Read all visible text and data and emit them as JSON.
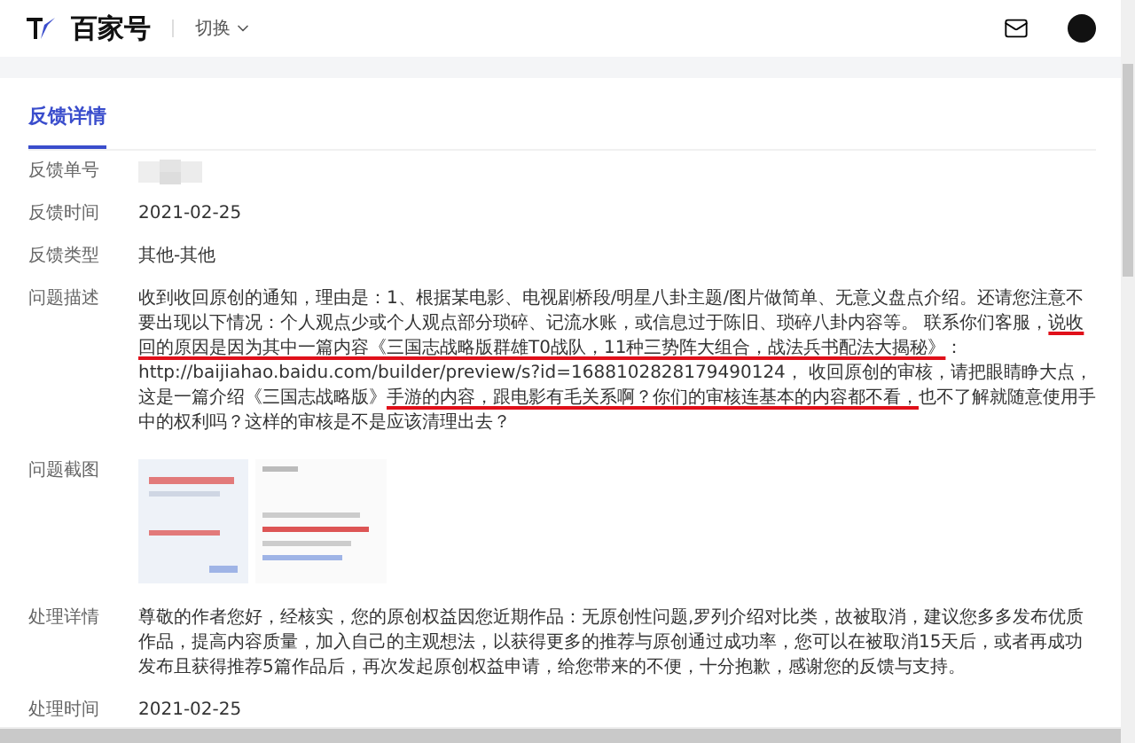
{
  "header": {
    "logo_text": "百家号",
    "switch_label": "切换"
  },
  "tabs": [
    {
      "label": "反馈详情",
      "selected": true
    }
  ],
  "fields": [
    {
      "kind": "redacted",
      "label": "反馈单号"
    },
    {
      "kind": "text",
      "label": "反馈时间",
      "value": "2021-02-25"
    },
    {
      "kind": "text",
      "label": "反馈类型",
      "value": "其他-其他"
    },
    {
      "kind": "marked",
      "label": "问题描述",
      "segments": [
        {
          "text": "收到收回原创的通知，理由是：1、根据某电影、电视剧桥段/明星八卦主题/图片做简单、无意义盘点介绍。还请您注意不要出现以下情况：个人观点少或个人观点部分琐碎、记流水账，或信息过于陈旧、琐碎八卦内容等。 联系你们客服，",
          "marked": false
        },
        {
          "text": "说收回的原因是因为其中一篇内容《三国志战略版群雄T0战队，11种三势阵大组合，战法兵书配法大揭秘》",
          "marked": true
        },
        {
          "text": "：http://baijiahao.baidu.com/builder/preview/s?id=1688102828179490124， 收回原创的审核，请把眼睛睁大点，这是一篇介绍《三国志战略版》",
          "marked": false
        },
        {
          "text": "手游的内容，跟电影有毛关系啊？你们的审核连基本的内容都不看，",
          "marked": true
        },
        {
          "text": "也不了解就随意使用手中的权利吗？这样的审核是不是应该清理出去？",
          "marked": false
        }
      ]
    },
    {
      "kind": "picture",
      "label": "问题截图"
    },
    {
      "kind": "text",
      "label": "处理详情",
      "value": "尊敬的作者您好，经核实，您的原创权益因您近期作品：无原创性问题,罗列介绍对比类，故被取消，建议您多多发布优质作品，提高内容质量，加入自己的主观想法，以获得更多的推荐与原创通过成功率，您可以在被取消15天后，或者再成功发布且获得推荐5篇作品后，再次发起原创权益申请，给您带来的不便，十分抱歉，感谢您的反馈与支持。"
    },
    {
      "kind": "text",
      "label": "处理时间",
      "value": "2021-02-25"
    }
  ]
}
